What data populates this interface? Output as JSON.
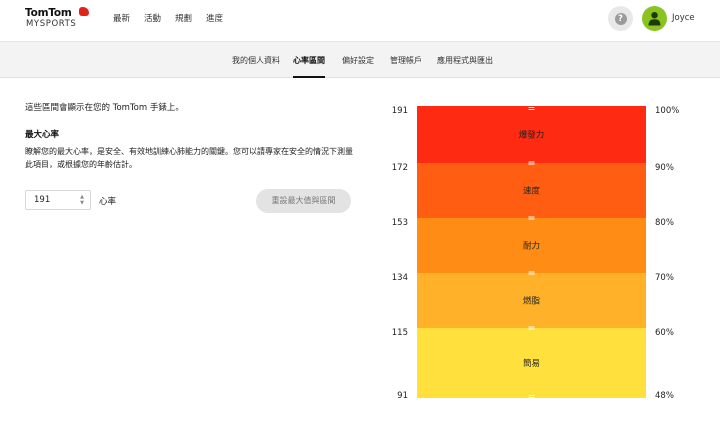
{
  "header": {
    "logo_top": "TomTom",
    "logo_bottom": "MYSPORTS",
    "nav": [
      "最新",
      "活動",
      "規劃",
      "進度"
    ],
    "help_icon": "?",
    "username": "Joyce"
  },
  "subnav": {
    "items": [
      "我的個人資料",
      "心率區間",
      "偏好設定",
      "管理帳戶",
      "應用程式與匯出"
    ],
    "active": "心率區間"
  },
  "content": {
    "intro": "這些區間會顯示在您的 TomTom 手錶上。",
    "section_title": "最大心率",
    "description": "瞭解您的最大心率，是安全、有效地訓練心肺能力的關鍵。您可以請專家在安全的情況下測量此項目，或根據您的年齡估計。",
    "max_hr_value": "191",
    "max_hr_unit": "心率",
    "reset_button": "重設最大值與區間"
  },
  "zones": [
    {
      "name": "爆發力",
      "bpm_top": "191",
      "pct_top": "100%",
      "color": "#fe2a12"
    },
    {
      "name": "速度",
      "bpm_top": "172",
      "pct_top": "90%",
      "color": "#ff5d12"
    },
    {
      "name": "耐力",
      "bpm_top": "153",
      "pct_top": "80%",
      "color": "#ff8c14"
    },
    {
      "name": "燃脂",
      "bpm_top": "134",
      "pct_top": "70%",
      "color": "#ffb229"
    },
    {
      "name": "簡易",
      "bpm_top": "115",
      "pct_top": "60%",
      "color": "#ffe03c"
    }
  ],
  "zone_bottom": {
    "bpm": "91",
    "pct": "48%"
  },
  "colors": {
    "accent_green": "#8bc320",
    "brand_red": "#e2231a"
  }
}
